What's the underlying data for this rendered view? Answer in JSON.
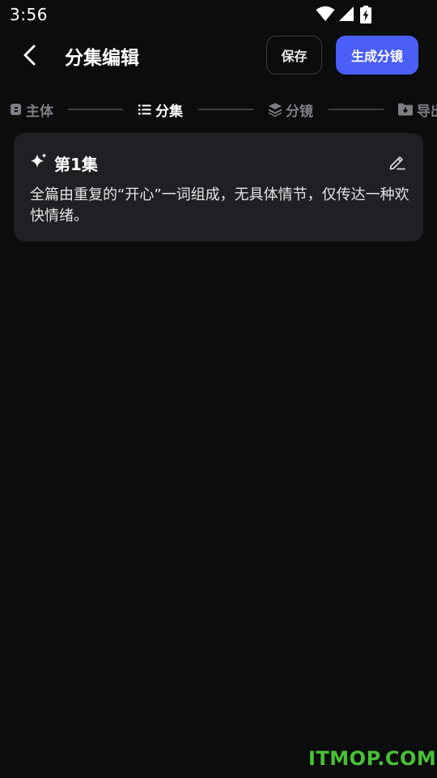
{
  "status_bar": {
    "time": "3:56",
    "icons": [
      "wifi-icon",
      "signal-icon",
      "battery-charging-icon"
    ]
  },
  "header": {
    "back_icon": "chevron-left-icon",
    "title": "分集编辑",
    "save_label": "保存",
    "generate_label": "生成分镜"
  },
  "steps": [
    {
      "label": "主体",
      "icon": "subject-icon",
      "active": false
    },
    {
      "label": "分集",
      "icon": "list-icon",
      "active": true
    },
    {
      "label": "分镜",
      "icon": "layers-icon",
      "active": false
    },
    {
      "label": "导出",
      "icon": "export-folder-icon",
      "active": false
    }
  ],
  "episodes": [
    {
      "icon": "sparkle-icon",
      "title": "第1集",
      "summary": "全篇由重复的“开心”一词组成，无具体情节，仅传达一种欢快情绪。",
      "edit_icon": "edit-icon"
    }
  ],
  "watermark": "ITMOP.COM",
  "colors": {
    "background": "#0b0c0c",
    "card": "#1e2023",
    "accent": "#4b5ef8",
    "muted_text": "#7c7f84",
    "watermark": "#49c038"
  }
}
